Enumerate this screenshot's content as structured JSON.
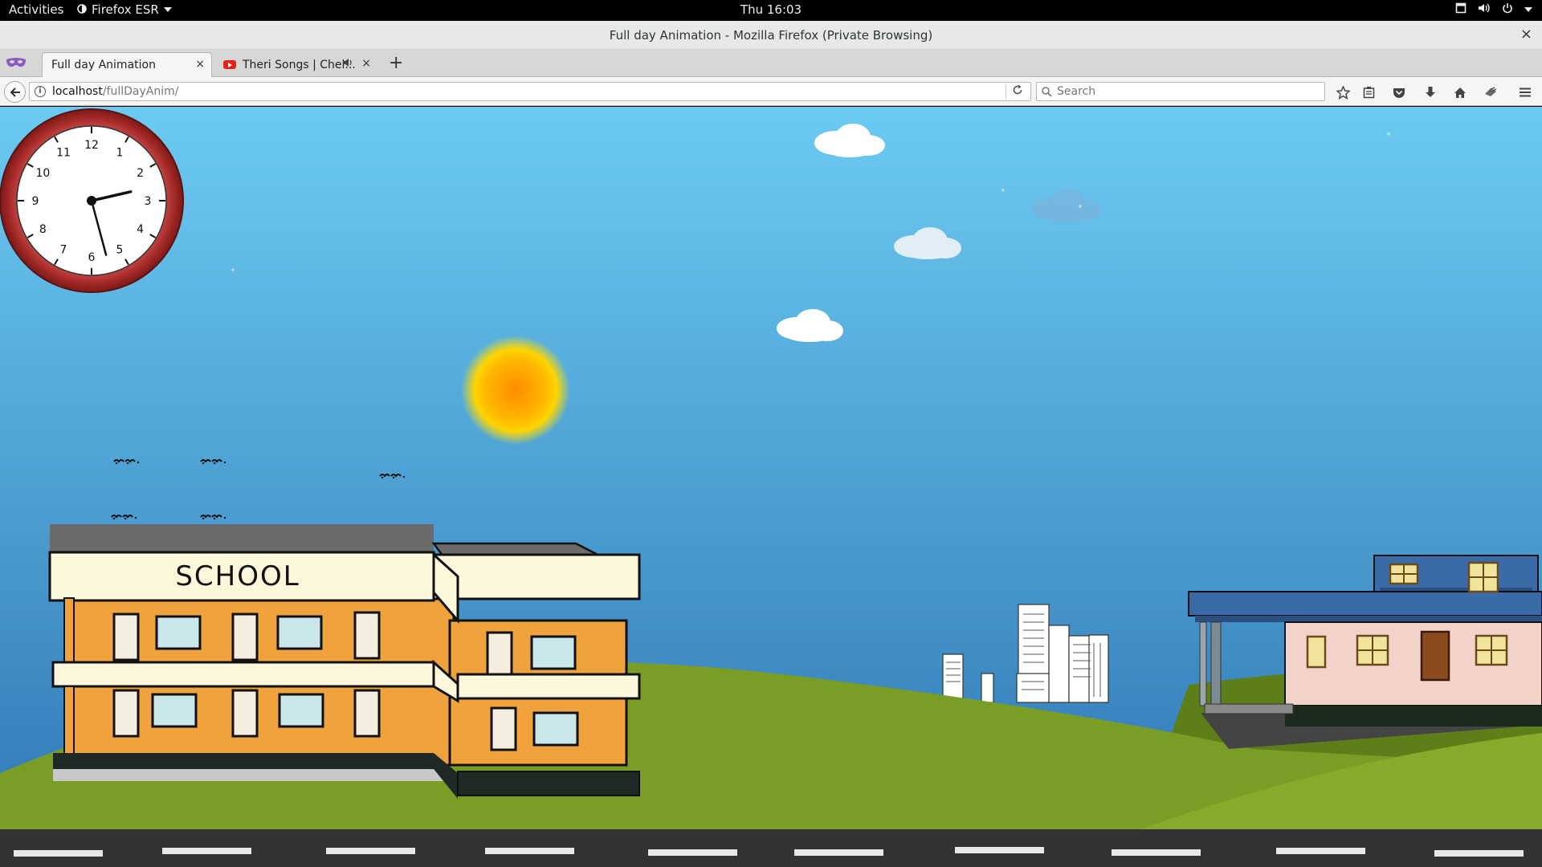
{
  "topbar": {
    "activities": "Activities",
    "app_name": "Firefox ESR",
    "clock": "Thu 16:03"
  },
  "window": {
    "title": "Full day Animation - Mozilla Firefox (Private Browsing)",
    "close_glyph": "×"
  },
  "tabs": [
    {
      "label": "Full day Animation",
      "close": "×",
      "active": true
    },
    {
      "label": "Theri Songs | Chel...",
      "close": "×",
      "audio": "🔊",
      "active": false
    }
  ],
  "new_tab_glyph": "+",
  "url": {
    "host": "localhost",
    "path": "/fullDayAnim/",
    "info_glyph": "i"
  },
  "search": {
    "placeholder": "Search"
  },
  "toolbar_icons": [
    "bookmark-star-icon",
    "reader-list-icon",
    "pocket-icon",
    "downloads-icon",
    "home-icon",
    "extension-icon",
    "menu-icon"
  ],
  "scene": {
    "clock_numerals": [
      "12",
      "1",
      "2",
      "3",
      "4",
      "5",
      "6",
      "7",
      "8",
      "9",
      "10",
      "11"
    ],
    "clock_time": {
      "hour": 2.57,
      "minute": 27.5
    },
    "school_sign": "SCHOOL",
    "colors": {
      "sky_top": "#6ccbf2",
      "sky_bottom": "#2f75b4",
      "grass": "#7a9e25",
      "road": "#333333",
      "sun": "#ffb700",
      "clock_rim": "#a62a28",
      "school_wall": "#f0a33c",
      "school_trim": "#fdf8dc",
      "house_wall": "#f2d3c9",
      "house_roof": "#3b6aa8"
    }
  }
}
